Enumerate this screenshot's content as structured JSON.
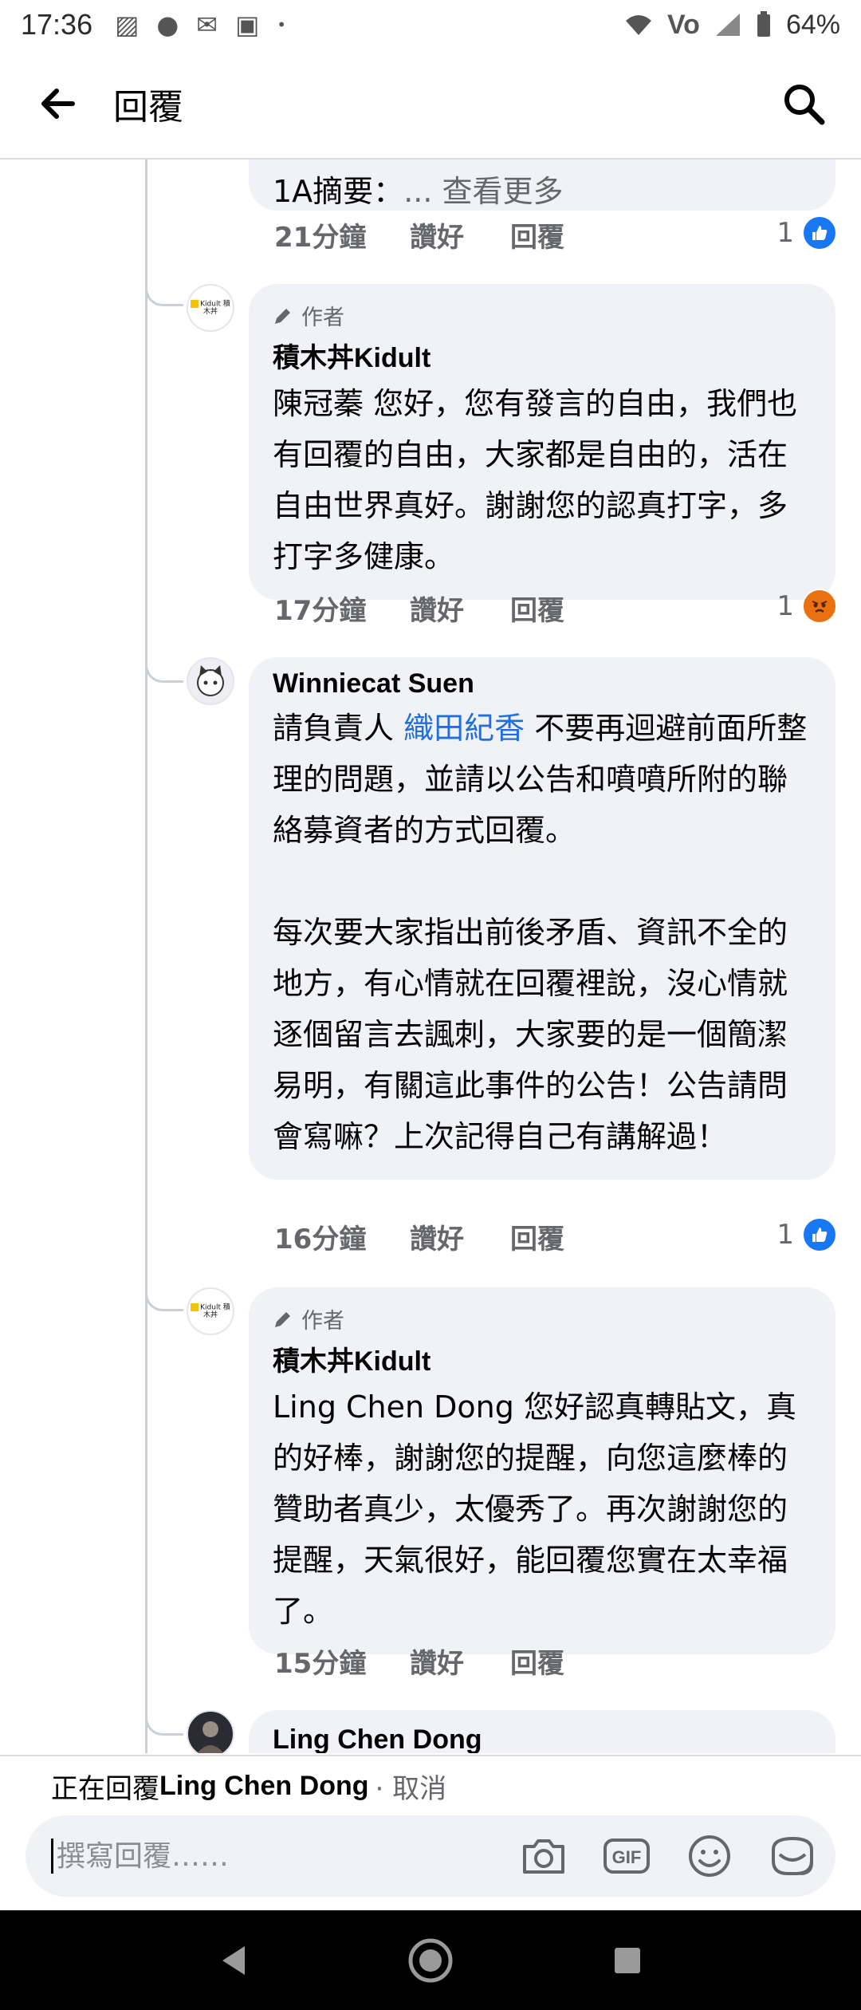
{
  "status_bar": {
    "time": "17:36",
    "battery": "64%",
    "left_icons": [
      "gallery-icon",
      "cat-icon",
      "gmail-icon",
      "photo-icon",
      "dot-icon"
    ],
    "right_icons": [
      "wifi-icon",
      "volte-icon",
      "signal-icon",
      "battery-icon"
    ]
  },
  "app_bar": {
    "title": "回覆"
  },
  "comments": [
    {
      "id": "truncated",
      "text": "1A摘要：",
      "see_more": "... 查看更多",
      "time": "21分鐘",
      "like": "讚好",
      "reply": "回覆",
      "reaction_count": "1",
      "reaction_type": "like"
    },
    {
      "id": "kidult-1",
      "author_badge": "作者",
      "author": "積木丼Kidult",
      "avatar_label": "Kidult 積木丼",
      "text": "陳冠蓁 您好，您有發言的自由，我們也有回覆的自由，大家都是自由的，活在自由世界真好。謝謝您的認真打字，多打字多健康。",
      "time": "17分鐘",
      "like": "讚好",
      "reply": "回覆",
      "reaction_count": "1",
      "reaction_type": "angry"
    },
    {
      "id": "winnie",
      "author": "Winniecat Suen",
      "text_before": "請負責人 ",
      "mention": "織田紀香",
      "text_after": " 不要再迴避前面所整理的問題，並請以公告和噴噴所附的聯絡募資者的方式回覆。\n\n每次要大家指出前後矛盾、資訊不全的地方，有心情就在回覆裡說，沒心情就逐個留言去諷刺，大家要的是一個簡潔易明，有關這此事件的公告！公告請問會寫嘛？上次記得自己有講解過！",
      "time": "16分鐘",
      "like": "讚好",
      "reply": "回覆",
      "reaction_count": "1",
      "reaction_type": "like"
    },
    {
      "id": "kidult-2",
      "author_badge": "作者",
      "author": "積木丼Kidult",
      "avatar_label": "Kidult 積木丼",
      "text": "Ling Chen Dong 您好認真轉貼文，真的好棒，謝謝您的提醒，向您這麼棒的贊助者真少，太優秀了。再次謝謝您的提醒，天氣很好，能回覆您實在太幸福了。",
      "time": "15分鐘",
      "like": "讚好",
      "reply": "回覆"
    },
    {
      "id": "ling",
      "author": "Ling Chen Dong"
    }
  ],
  "composer": {
    "replying_prefix": "正在回覆",
    "replying_name": "Ling Chen Dong",
    "cancel": "· 取消",
    "placeholder": "撰寫回覆……",
    "icons": [
      "camera-icon",
      "gif-icon",
      "emoji-icon",
      "sticker-icon"
    ]
  },
  "colors": {
    "bubble": "#f0f2f5",
    "mention": "#216fdb",
    "like_blue": "#1877f2",
    "angry_orange": "#e9710f",
    "secondary_text": "#65676b"
  }
}
